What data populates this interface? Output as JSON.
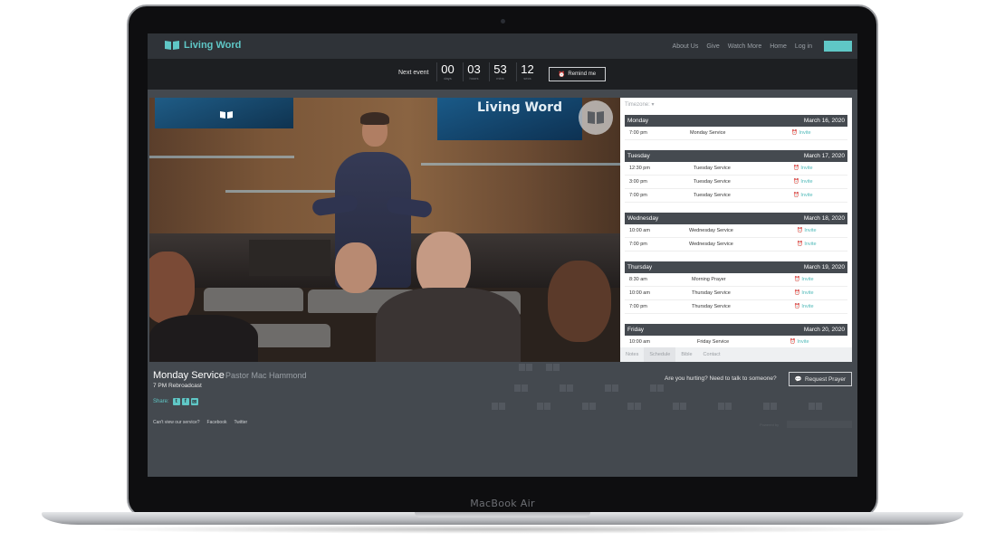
{
  "device": {
    "label": "MacBook Air"
  },
  "nav": {
    "logo_text": "Living Word",
    "items": [
      {
        "label": "About Us"
      },
      {
        "label": "Give"
      },
      {
        "label": "Watch More"
      },
      {
        "label": "Home"
      },
      {
        "label": "Log in"
      }
    ]
  },
  "countdown": {
    "label": "Next event",
    "units": [
      {
        "value": "00",
        "unit": "days"
      },
      {
        "value": "03",
        "unit": "hours"
      },
      {
        "value": "53",
        "unit": "mins"
      },
      {
        "value": "12",
        "unit": "secs"
      }
    ],
    "remind_label": "Remind me"
  },
  "video": {
    "screen_title": "Living Word"
  },
  "schedule": {
    "timezone_label": "Timezone: ▾",
    "days": [
      {
        "day": "Monday",
        "date": "March 16, 2020",
        "events": [
          {
            "time": "7:00 pm",
            "name": "Monday Service",
            "invite": "Invite"
          }
        ]
      },
      {
        "day": "Tuesday",
        "date": "March 17, 2020",
        "events": [
          {
            "time": "12:30 pm",
            "name": "Tuesday Service",
            "invite": "Invite"
          },
          {
            "time": "3:00 pm",
            "name": "Tuesday Service",
            "invite": "Invite"
          },
          {
            "time": "7:00 pm",
            "name": "Tuesday Service",
            "invite": "Invite"
          }
        ]
      },
      {
        "day": "Wednesday",
        "date": "March 18, 2020",
        "events": [
          {
            "time": "10:00 am",
            "name": "Wednesday Service",
            "invite": "Invite"
          },
          {
            "time": "7:00 pm",
            "name": "Wednesday Service",
            "invite": "Invite"
          }
        ]
      },
      {
        "day": "Thursday",
        "date": "March 19, 2020",
        "events": [
          {
            "time": "8:30 am",
            "name": "Morning Prayer",
            "invite": "Invite"
          },
          {
            "time": "10:00 am",
            "name": "Thursday Service",
            "invite": "Invite"
          },
          {
            "time": "7:00 pm",
            "name": "Thursday Service",
            "invite": "Invite"
          }
        ]
      },
      {
        "day": "Friday",
        "date": "March 20, 2020",
        "events": [
          {
            "time": "10:00 am",
            "name": "Friday Service",
            "invite": "Invite"
          }
        ]
      }
    ],
    "tabs": [
      {
        "label": "Notes",
        "active": false
      },
      {
        "label": "Schedule",
        "active": true
      },
      {
        "label": "Bible",
        "active": false
      },
      {
        "label": "Contact",
        "active": false
      }
    ]
  },
  "service": {
    "title": "Monday Service",
    "pastor": "Pastor Mac Hammond",
    "subtitle": "7 PM Rebroadcast",
    "share_label": "Share:",
    "share_icons": [
      "twitter-icon",
      "facebook-icon",
      "email-icon"
    ],
    "links": [
      {
        "label": "Can't view our service?"
      },
      {
        "label": "Facebook"
      },
      {
        "label": "Twitter"
      }
    ],
    "prayer_prompt": "Are you hurting? Need to talk to someone?",
    "request_prayer_label": "Request Prayer",
    "powered_by": "Powered by"
  },
  "colors": {
    "accent": "#5fc7c6",
    "nav_bg": "#2f3338",
    "page_bg": "#44494f",
    "schedule_header": "#454a50"
  }
}
